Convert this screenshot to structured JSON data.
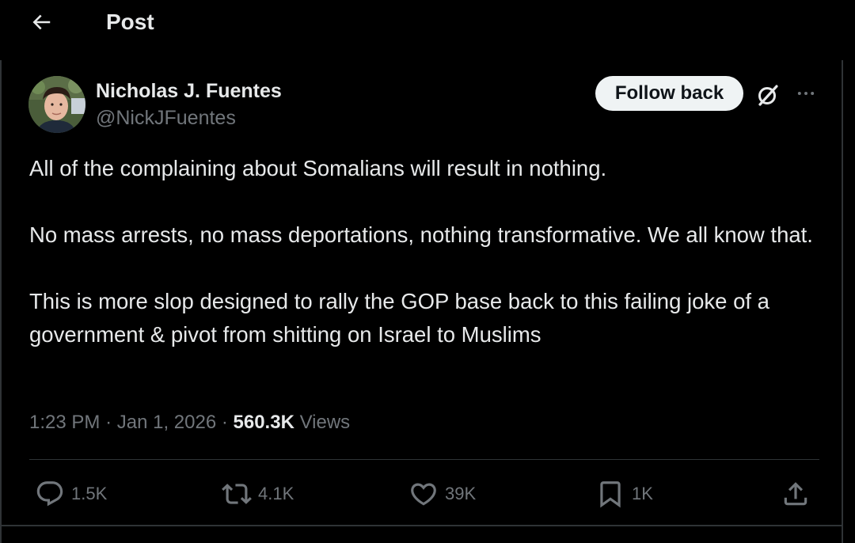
{
  "header": {
    "title": "Post",
    "back_icon": "arrow-left-icon"
  },
  "post": {
    "author": {
      "display_name": "Nicholas J. Fuentes",
      "handle": "@NickJFuentes"
    },
    "follow_button_label": "Follow back",
    "grok_icon": "grok-icon",
    "more_icon": "more-horizontal-icon",
    "text": {
      "paragraph_1": "All of the complaining about Somalians will result in nothing.",
      "paragraph_2": "No mass arrests, no mass deportations, nothing transformative. We all know that.",
      "paragraph_3": "This is more slop designed to rally the GOP base back to this failing joke of a government & pivot from shitting on Israel to Muslims"
    },
    "meta": {
      "time": "1:23 PM",
      "date": "Jan 1, 2026",
      "views_count": "560.3K",
      "views_label": "Views"
    },
    "actions": {
      "replies": "1.5K",
      "reposts": "4.1K",
      "likes": "39K",
      "bookmarks": "1K"
    }
  },
  "colors": {
    "background": "#000000",
    "primary_text": "#e7e9ea",
    "secondary_text": "#71767b",
    "border": "#2f3336",
    "follow_button_bg": "#eff3f4"
  }
}
